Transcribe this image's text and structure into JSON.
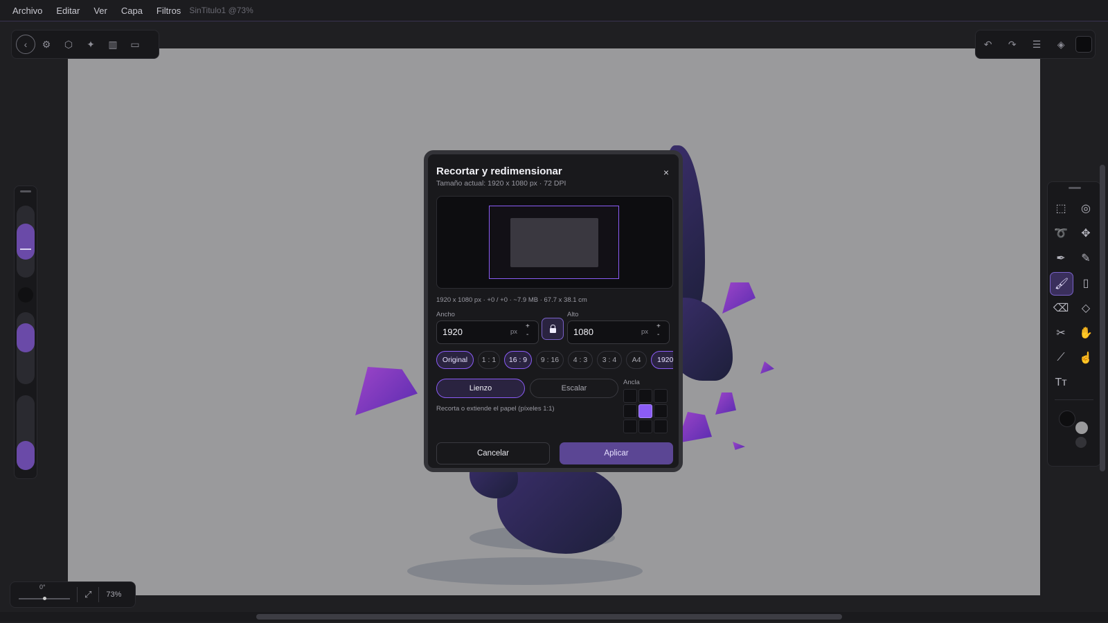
{
  "menu": {
    "items": [
      "Archivo",
      "Editar",
      "Ver",
      "Capa",
      "Filtros"
    ],
    "doc_title": "SinTitulo1 @73%"
  },
  "toolbar_left": {
    "icons": [
      "back-icon",
      "gear-icon",
      "cube-icon",
      "magic-wand-icon",
      "gradient-icon",
      "window-icon"
    ]
  },
  "toolbar_right": {
    "icons": [
      "undo-icon",
      "redo-icon",
      "sliders-icon",
      "layers-icon"
    ],
    "color": "#0c0c0e"
  },
  "bottom": {
    "rotation": "0°",
    "zoom": "73%"
  },
  "dialog": {
    "title": "Recortar y redimensionar",
    "subtitle": "Tamaño actual: 1920 x 1080 px · 72 DPI",
    "close": "×",
    "info": "1920 x 1080 px · +0 / +0 · ~7.9 MB · 67.7 x 38.1 cm",
    "width_label": "Ancho",
    "width_value": "1920",
    "width_unit": "px",
    "height_label": "Alto",
    "height_value": "1080",
    "height_unit": "px",
    "plus": "+",
    "minus": "-",
    "presets": [
      "Original",
      "1 : 1",
      "16 : 9",
      "9 : 16",
      "4 : 3",
      "3 : 4",
      "A4",
      "1920"
    ],
    "selected_presets": [
      "Original",
      "16 : 9",
      "1920"
    ],
    "mode_canvas": "Lienzo",
    "mode_scale": "Escalar",
    "hint": "Recorta o extiende el papel (píxeles 1:1)",
    "anchor_label": "Ancla",
    "anchor_selected": "center",
    "cancel": "Cancelar",
    "apply": "Aplicar",
    "accent": "#8b5cf6"
  }
}
